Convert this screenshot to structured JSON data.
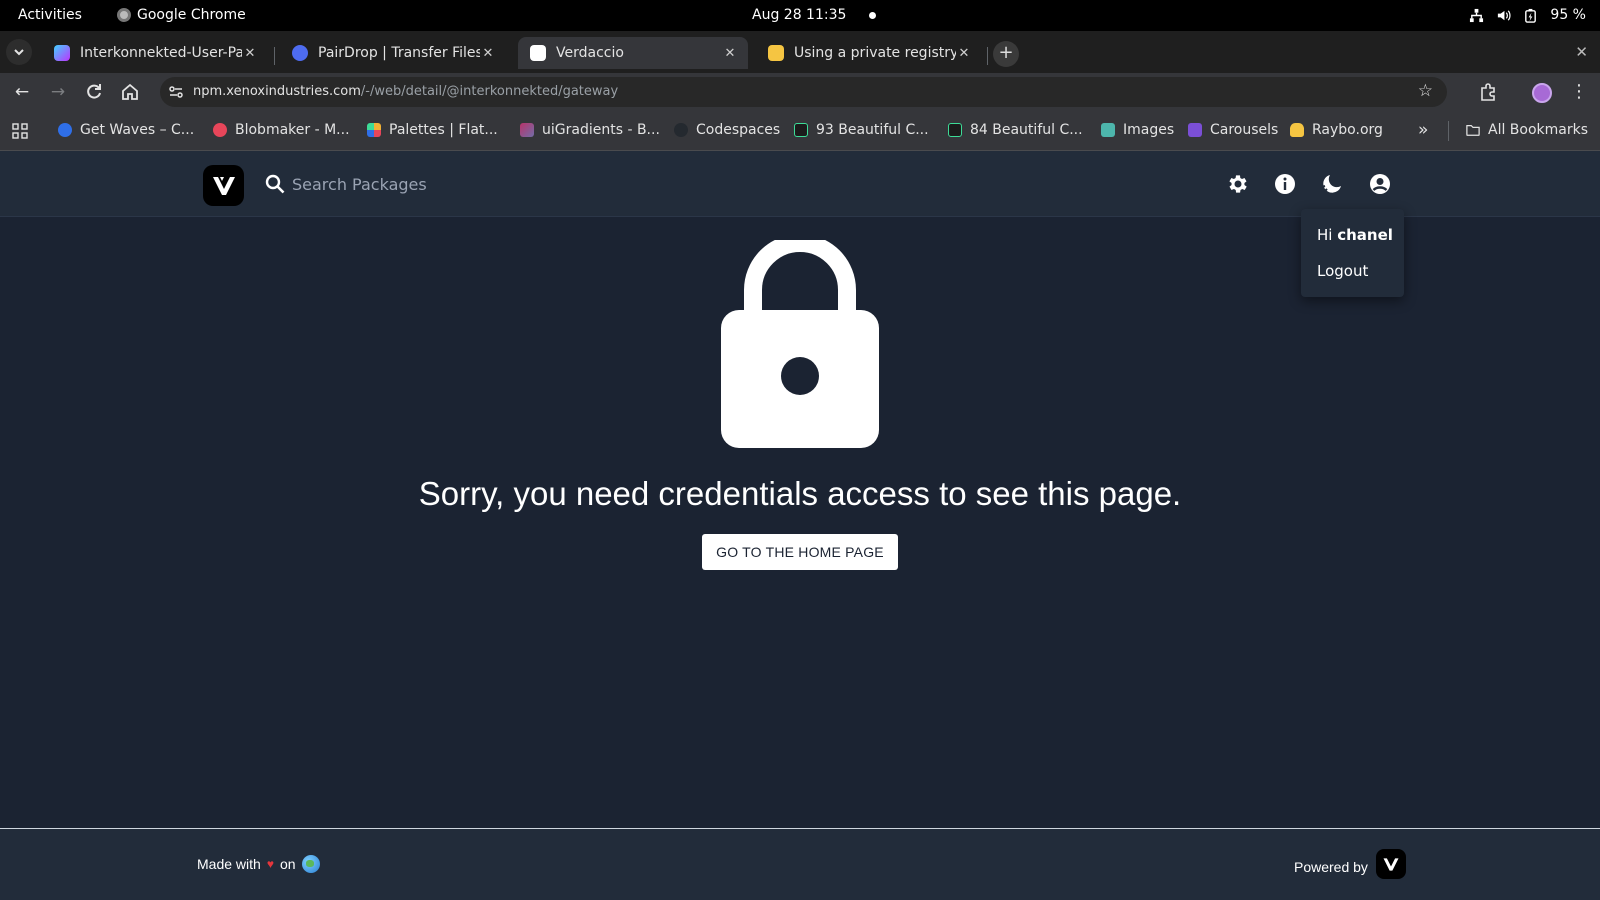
{
  "system_bar": {
    "activities": "Activities",
    "app_name": "Google Chrome",
    "clock": "Aug 28  11:35",
    "battery": "95 %"
  },
  "tabs": [
    {
      "title": "Interkonnekted-User-Par",
      "active": false,
      "favicon": "vite-icon"
    },
    {
      "title": "PairDrop | Transfer Files",
      "active": false,
      "favicon": "pairdrop-icon"
    },
    {
      "title": "Verdaccio",
      "active": true,
      "favicon": "verdaccio-icon"
    },
    {
      "title": "Using a private registry | V",
      "active": false,
      "favicon": "verdaccio-icon"
    }
  ],
  "address_bar": {
    "host": "npm.xenoxindustries.com",
    "path": "/-/web/detail/@interkonnekted/gateway"
  },
  "bookmarks": [
    {
      "label": "Get Waves – C...",
      "color": "#2f6fe8"
    },
    {
      "label": "Blobmaker - M...",
      "color": "#e8465a"
    },
    {
      "label": "Palettes | Flat...",
      "color": "#f2b134"
    },
    {
      "label": "uiGradients - B...",
      "color": "#b8336a"
    },
    {
      "label": "Codespaces",
      "color": "#24292f"
    },
    {
      "label": "93 Beautiful C...",
      "color": "#3ddc97"
    },
    {
      "label": "84 Beautiful C...",
      "color": "#3ddc97"
    },
    {
      "label": "Images",
      "color": "#4db6ac"
    },
    {
      "label": "Carousels",
      "color": "#7b4fd6"
    },
    {
      "label": "Raybo.org",
      "color": "#f5c542"
    }
  ],
  "all_bookmarks": "All Bookmarks",
  "verdaccio": {
    "search_placeholder": "Search Packages",
    "user_menu": {
      "greeting": "Hi",
      "username": "chanel",
      "logout": "Logout"
    },
    "error_message": "Sorry, you need credentials access to see this page.",
    "home_button": "GO TO THE HOME PAGE",
    "footer": {
      "made_with": "Made with",
      "on": "on",
      "powered_by": "Powered by"
    }
  },
  "colors": {
    "page_bg": "#1b2332",
    "header_bg": "#222c3a",
    "heart": "#e5363c"
  }
}
